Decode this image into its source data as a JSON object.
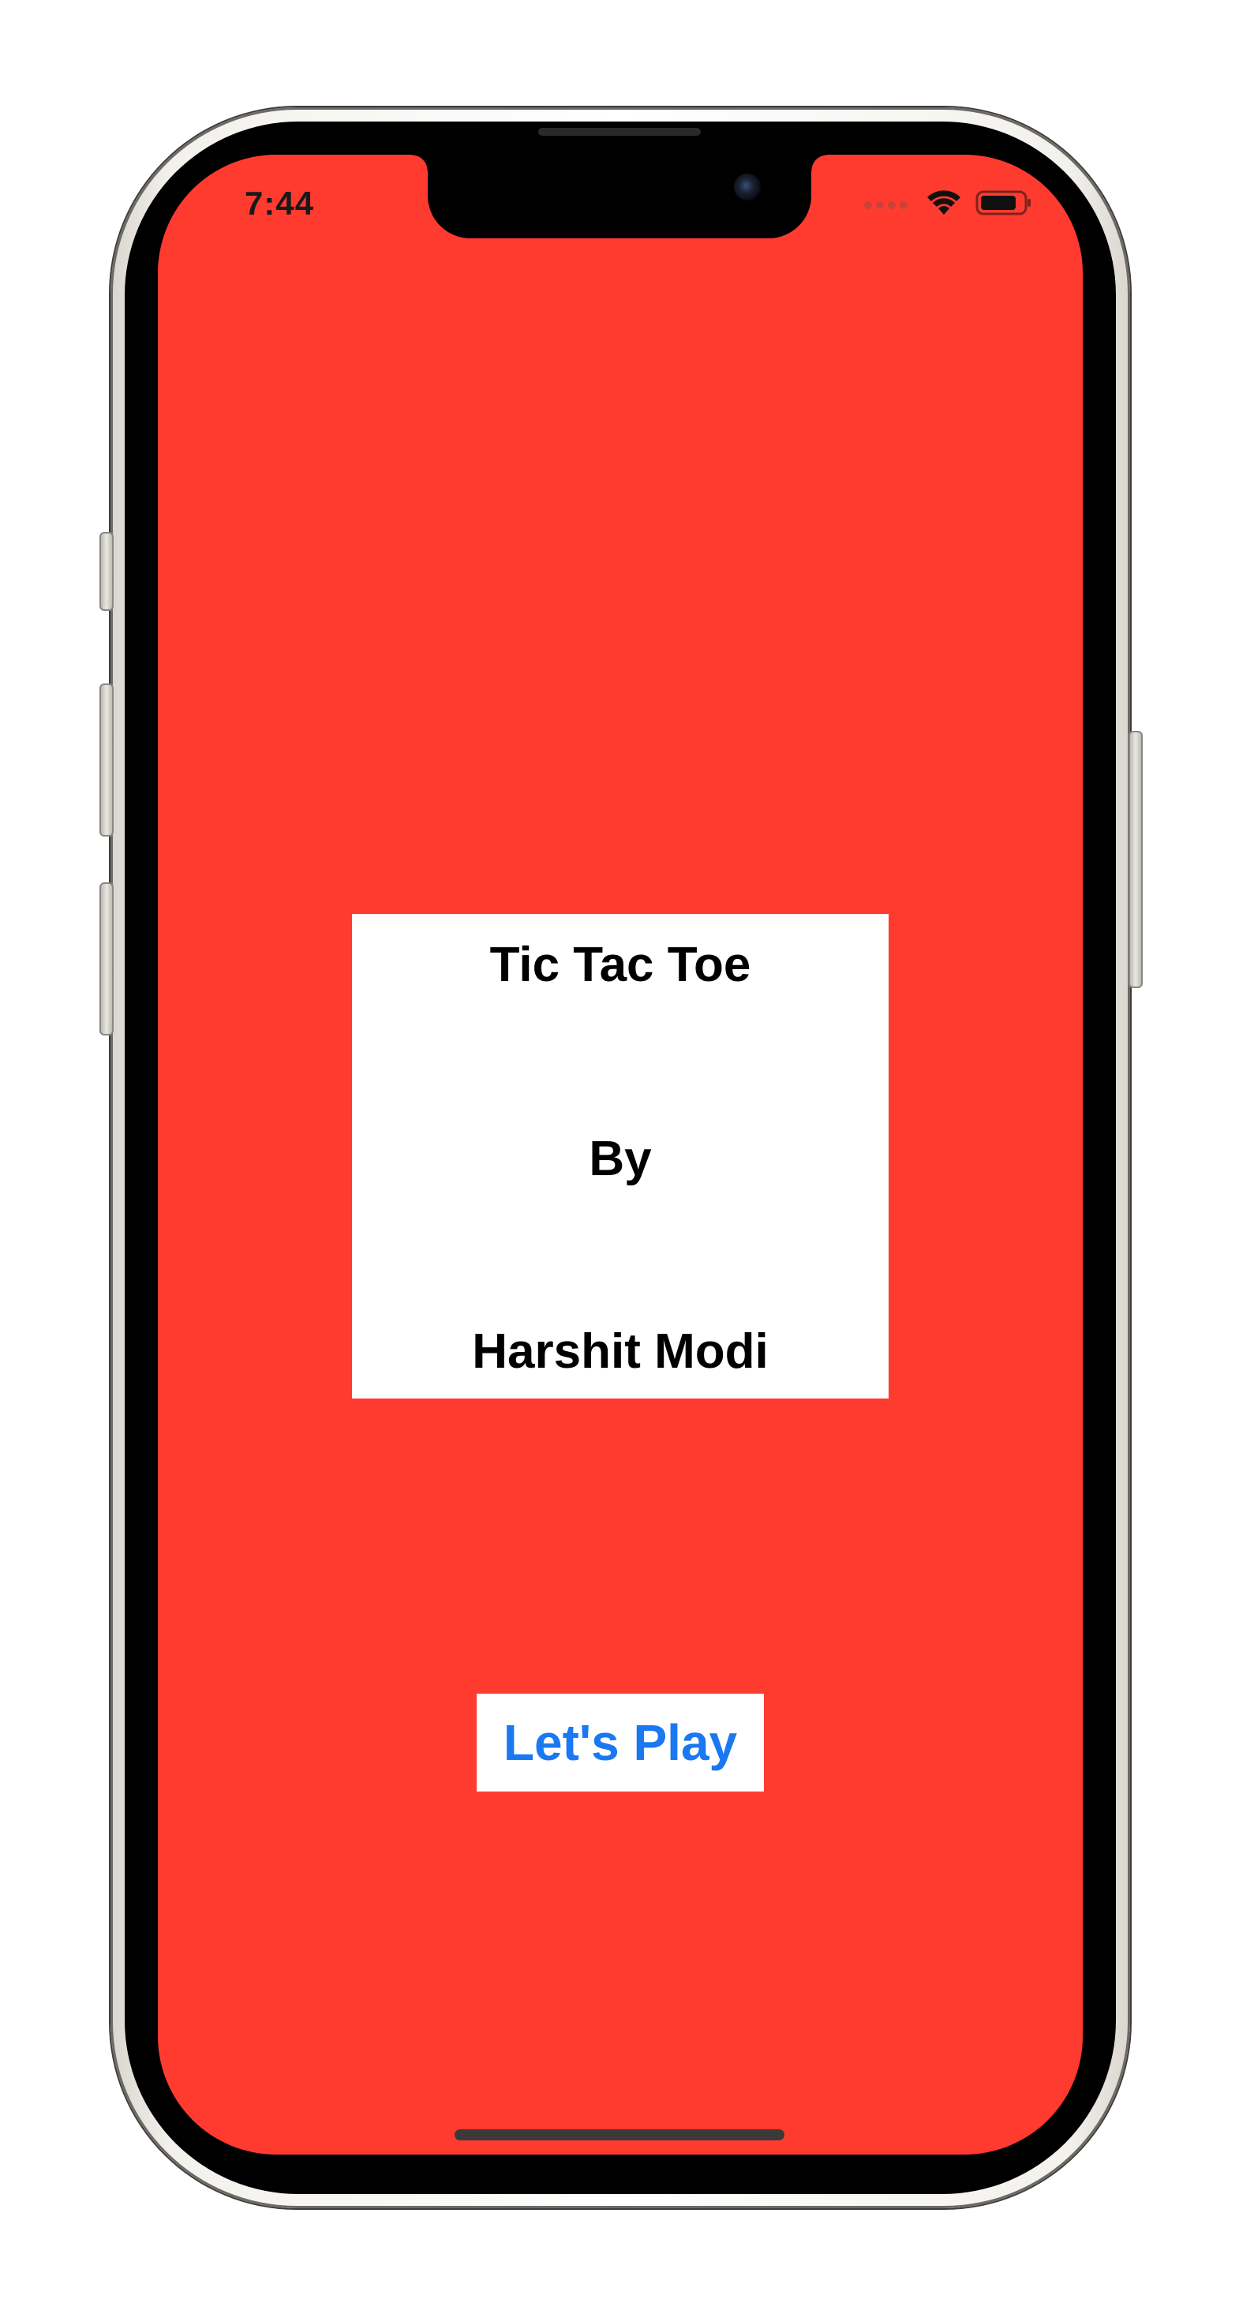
{
  "status_bar": {
    "time": "7:44",
    "icons": [
      "cellular-signal-icon",
      "wifi-icon",
      "battery-icon"
    ]
  },
  "title_card": {
    "line1": "Tic Tac Toe",
    "line2": "By",
    "line3": "Harshit Modi"
  },
  "play_button": {
    "label": "Let's Play"
  },
  "colors": {
    "background": "#ff3b30",
    "card": "#ffffff",
    "button_text": "#1a78f2",
    "title_text": "#000000"
  }
}
